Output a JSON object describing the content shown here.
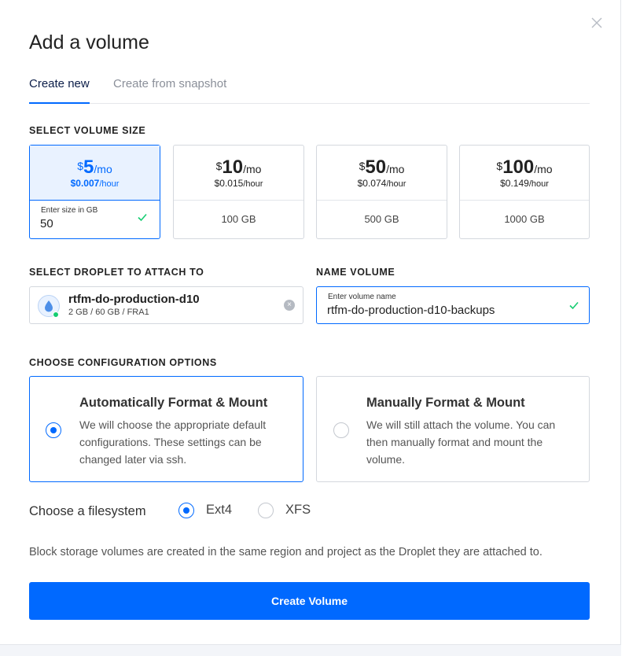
{
  "dialog": {
    "title": "Add a volume",
    "close_icon": "close-icon"
  },
  "tabs": [
    {
      "label": "Create new",
      "active": true
    },
    {
      "label": "Create from snapshot",
      "active": false
    }
  ],
  "size_section": {
    "label": "SELECT VOLUME SIZE",
    "options": [
      {
        "dollar": "$",
        "amount": "5",
        "per": "/mo",
        "hourly": "$0.007",
        "hourly_unit": "/hour",
        "gb": "50",
        "selected": true
      },
      {
        "dollar": "$",
        "amount": "10",
        "per": "/mo",
        "hourly": "$0.015",
        "hourly_unit": "/hour",
        "gb": "100 GB",
        "selected": false
      },
      {
        "dollar": "$",
        "amount": "50",
        "per": "/mo",
        "hourly": "$0.074",
        "hourly_unit": "/hour",
        "gb": "500 GB",
        "selected": false
      },
      {
        "dollar": "$",
        "amount": "100",
        "per": "/mo",
        "hourly": "$0.149",
        "hourly_unit": "/hour",
        "gb": "1000 GB",
        "selected": false
      }
    ],
    "input_label": "Enter size in GB",
    "input_value": "50"
  },
  "droplet_section": {
    "label": "SELECT DROPLET TO ATTACH TO",
    "name": "rtfm-do-production-d10",
    "meta": "2 GB / 60 GB / FRA1",
    "clear": "×"
  },
  "name_section": {
    "label": "NAME VOLUME",
    "input_label": "Enter volume name",
    "input_value": "rtfm-do-production-d10-backups"
  },
  "config_section": {
    "label": "CHOOSE CONFIGURATION OPTIONS",
    "options": [
      {
        "title": "Automatically Format & Mount",
        "description": "We will choose the appropriate default configurations. These settings can be changed later via ssh.",
        "selected": true
      },
      {
        "title": "Manually Format & Mount",
        "description": "We will still attach the volume. You can then manually format and mount the volume.",
        "selected": false
      }
    ]
  },
  "filesystem": {
    "label": "Choose a filesystem",
    "options": [
      {
        "label": "Ext4",
        "selected": true
      },
      {
        "label": "XFS",
        "selected": false
      }
    ]
  },
  "note": "Block storage volumes are created in the same region and project as the Droplet they are attached to.",
  "submit_label": "Create Volume",
  "colors": {
    "accent": "#0069ff",
    "success": "#15cd72"
  }
}
